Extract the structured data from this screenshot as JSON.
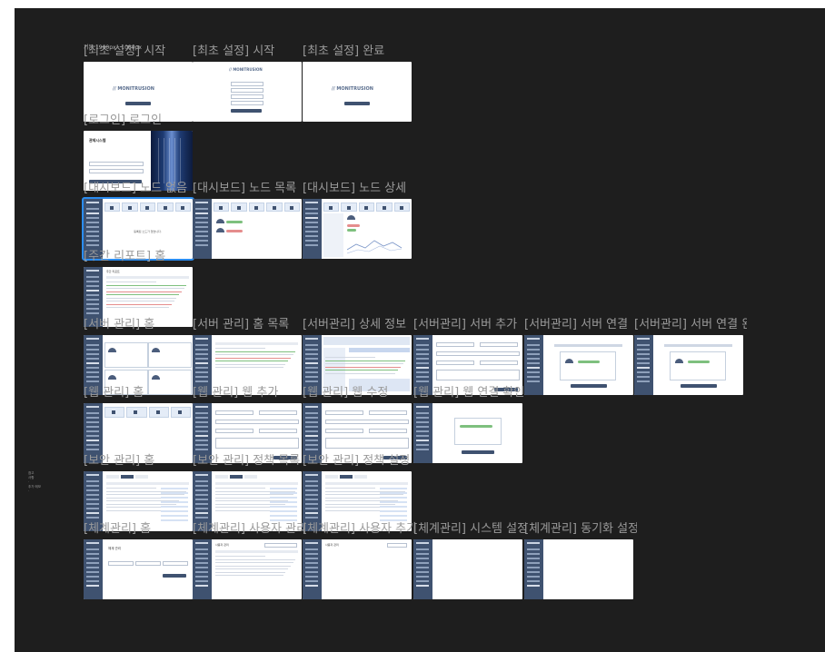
{
  "canvas": {
    "corner_label": "기본 1900px · 1080px",
    "side_note": [
      "참고",
      "사항",
      "·",
      "추가 메모",
      "·"
    ]
  },
  "frames": [
    {
      "id": "f1",
      "label": "[최초 설정] 시작",
      "kind": "splash"
    },
    {
      "id": "f2",
      "label": "[최초 설정] 시작",
      "kind": "setup-form"
    },
    {
      "id": "f3",
      "label": "[최초 설정] 완료",
      "kind": "splash"
    },
    {
      "id": "f4",
      "label": "[로그인] 로그인",
      "kind": "login"
    },
    {
      "id": "f5",
      "label": "[대시보드] 노드 없음",
      "kind": "dashboard-empty"
    },
    {
      "id": "f6",
      "label": "[대시보드] 노드 목록",
      "kind": "dashboard-list"
    },
    {
      "id": "f7",
      "label": "[대시보드] 노드 상세",
      "kind": "dashboard-detail"
    },
    {
      "id": "f8",
      "label": "[주간 리포트] 홈",
      "kind": "report"
    },
    {
      "id": "f9",
      "label": "[서버 관리] 홈",
      "kind": "server-home"
    },
    {
      "id": "f10",
      "label": "[서버 관리] 홈 목록",
      "kind": "server-table"
    },
    {
      "id": "f11",
      "label": "[서버관리] 상세 정보",
      "kind": "server-detail"
    },
    {
      "id": "f12",
      "label": "[서버관리] 서버 추가",
      "kind": "form"
    },
    {
      "id": "f13",
      "label": "[서버관리] 서버 연결",
      "kind": "connect"
    },
    {
      "id": "f14",
      "label": "[서버관리] 서버 연결 완료",
      "kind": "connect"
    },
    {
      "id": "f15",
      "label": "[웹 관리] 홈",
      "kind": "web-home"
    },
    {
      "id": "f16",
      "label": "[웹 관리] 웹 추가",
      "kind": "form"
    },
    {
      "id": "f17",
      "label": "[웹 관리] 웹 수정",
      "kind": "form"
    },
    {
      "id": "f18",
      "label": "[웹 관리] 웹 연결 확인",
      "kind": "web-check"
    },
    {
      "id": "f19",
      "label": "[보안 관리] 홈",
      "kind": "tabs-table"
    },
    {
      "id": "f20",
      "label": "[보안 관리] 정책 목록",
      "kind": "tabs-table"
    },
    {
      "id": "f21",
      "label": "[보안 관리] 정책 설정",
      "kind": "tabs-table"
    },
    {
      "id": "f22",
      "label": "[체계관리] 홈",
      "kind": "system-home"
    },
    {
      "id": "f23",
      "label": "[체계관리] 사용자 관리",
      "kind": "user-table"
    },
    {
      "id": "f24",
      "label": "[체계관리] 사용자 추가",
      "kind": "user-add"
    },
    {
      "id": "f25",
      "label": "[체계관리] 시스템 설정",
      "kind": "blank"
    },
    {
      "id": "f26",
      "label": "[체계관리] 동기화 설정",
      "kind": "blank"
    }
  ],
  "ui": {
    "brand": "MONITRUSION",
    "login_title": "관제시스템",
    "empty_message": "등록된 노드가 없습니다.",
    "report_title": "주간 리포트",
    "user_mgmt_title": "사용자 관리",
    "system_title": "체계 관리",
    "selected_frame": "f5"
  },
  "colors": {
    "canvas": "#1e1e1e",
    "sidebar": "#3f5270",
    "selection": "#2a8cf0",
    "label": "#9a9a9a"
  }
}
